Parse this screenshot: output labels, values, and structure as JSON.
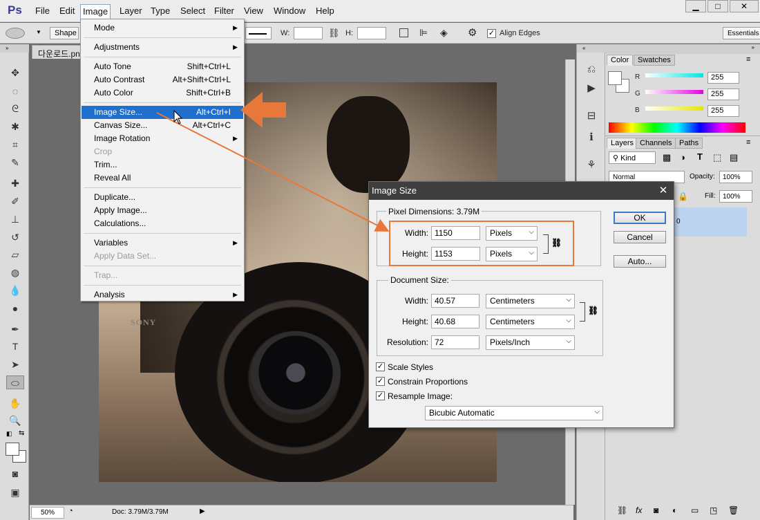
{
  "app": {
    "logo": "Ps"
  },
  "menubar": {
    "items": [
      "File",
      "Edit",
      "Image",
      "Layer",
      "Type",
      "Select",
      "Filter",
      "View",
      "Window",
      "Help"
    ],
    "active": "Image",
    "window_buttons": [
      "▁",
      "□",
      "✕"
    ]
  },
  "options_bar": {
    "shape_label": "Shape",
    "w_label": "W:",
    "h_label": "H:",
    "align_edges_label": "Align Edges",
    "align_edges_checked": true,
    "workspace": "Essentials"
  },
  "document": {
    "tab_title": "다운로드.png",
    "zoom": "50%",
    "doc_size": "Doc: 3.79M/3.79M",
    "photo_brand_text": "SONY"
  },
  "image_menu": {
    "items": [
      {
        "label": "Mode",
        "submenu": true
      },
      {
        "sep": true
      },
      {
        "label": "Adjustments",
        "submenu": true
      },
      {
        "sep": true
      },
      {
        "label": "Auto Tone",
        "shortcut": "Shift+Ctrl+L"
      },
      {
        "label": "Auto Contrast",
        "shortcut": "Alt+Shift+Ctrl+L"
      },
      {
        "label": "Auto Color",
        "shortcut": "Shift+Ctrl+B"
      },
      {
        "sep": true
      },
      {
        "label": "Image Size...",
        "shortcut": "Alt+Ctrl+I",
        "highlighted": true
      },
      {
        "label": "Canvas Size...",
        "shortcut": "Alt+Ctrl+C"
      },
      {
        "label": "Image Rotation",
        "submenu": true
      },
      {
        "label": "Crop",
        "disabled": true
      },
      {
        "label": "Trim..."
      },
      {
        "label": "Reveal All"
      },
      {
        "sep": true
      },
      {
        "label": "Duplicate..."
      },
      {
        "label": "Apply Image..."
      },
      {
        "label": "Calculations..."
      },
      {
        "sep": true
      },
      {
        "label": "Variables",
        "submenu": true
      },
      {
        "label": "Apply Data Set...",
        "disabled": true
      },
      {
        "sep": true
      },
      {
        "label": "Trap...",
        "disabled": true
      },
      {
        "sep": true
      },
      {
        "label": "Analysis",
        "submenu": true
      }
    ]
  },
  "color_panel": {
    "tabs": [
      "Color",
      "Swatches"
    ],
    "active_tab": "Color",
    "channels": [
      {
        "label": "R",
        "value": "255",
        "color": "#00e5e5"
      },
      {
        "label": "G",
        "value": "255",
        "color": "#e500e5"
      },
      {
        "label": "B",
        "value": "255",
        "color": "#e5e500"
      }
    ]
  },
  "layers_panel": {
    "tabs": [
      "Layers",
      "Channels",
      "Paths"
    ],
    "active_tab": "Layers",
    "filter_kind": "Kind",
    "blend_mode": "Normal",
    "opacity_label": "Opacity:",
    "opacity_value": "100%",
    "fill_label": "Fill:",
    "fill_value": "100%",
    "layer_name_fragment": "0"
  },
  "dialog": {
    "title": "Image Size",
    "close": "✕",
    "pixel_dimensions": {
      "legend": "Pixel Dimensions:",
      "size": "3.79M",
      "width_label": "Width:",
      "width_value": "1150",
      "width_unit": "Pixels",
      "height_label": "Height:",
      "height_value": "1153",
      "height_unit": "Pixels"
    },
    "document_size": {
      "legend": "Document Size:",
      "width_label": "Width:",
      "width_value": "40.57",
      "width_unit": "Centimeters",
      "height_label": "Height:",
      "height_value": "40.68",
      "height_unit": "Centimeters",
      "resolution_label": "Resolution:",
      "resolution_value": "72",
      "resolution_unit": "Pixels/Inch"
    },
    "options": [
      {
        "label": "Scale Styles",
        "checked": true
      },
      {
        "label": "Constrain Proportions",
        "checked": true
      },
      {
        "label": "Resample Image:",
        "checked": true
      }
    ],
    "resample_method": "Bicubic Automatic",
    "buttons": {
      "ok": "OK",
      "cancel": "Cancel",
      "auto": "Auto..."
    }
  },
  "annotation": {
    "color": "#e8773a"
  }
}
